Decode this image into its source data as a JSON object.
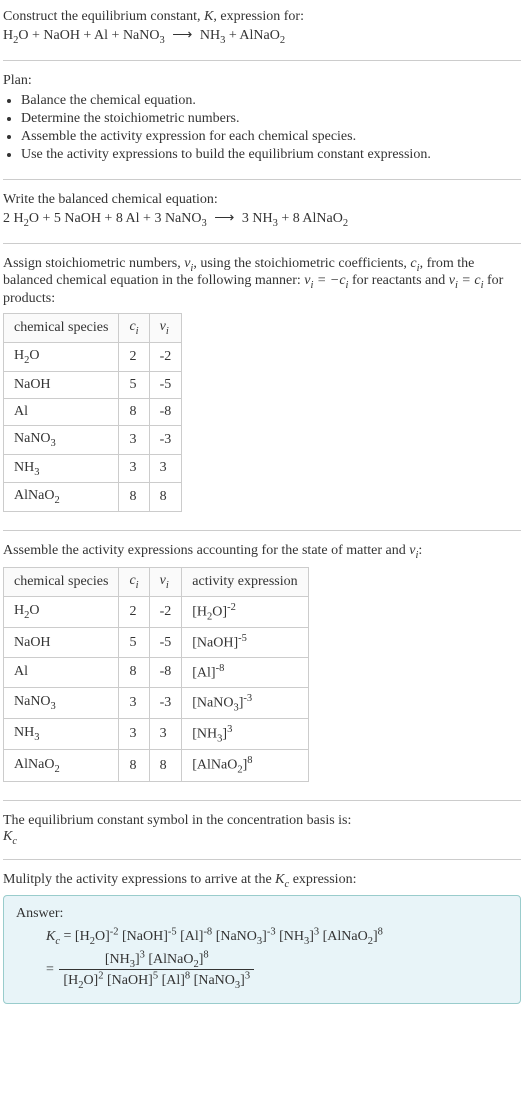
{
  "intro": {
    "line1_a": "Construct the equilibrium constant, ",
    "line1_k": "K",
    "line1_b": ", expression for:",
    "equation_lhs_parts": [
      "H",
      "2",
      "O + NaOH + Al + NaNO",
      "3"
    ],
    "equation_arrow": "⟶",
    "equation_rhs_parts": [
      "NH",
      "3",
      " + AlNaO",
      "2"
    ]
  },
  "plan": {
    "title": "Plan:",
    "items": [
      "Balance the chemical equation.",
      "Determine the stoichiometric numbers.",
      "Assemble the activity expression for each chemical species.",
      "Use the activity expressions to build the equilibrium constant expression."
    ]
  },
  "balanced": {
    "title": "Write the balanced chemical equation:",
    "lhs": "2 H₂O + 5 NaOH + 8 Al + 3 NaNO₃",
    "arrow": "⟶",
    "rhs": "3 NH₃ + 8 AlNaO₂"
  },
  "assign": {
    "text_a": "Assign stoichiometric numbers, ",
    "nu_i": "νᵢ",
    "text_b": ", using the stoichiometric coefficients, ",
    "c_i": "cᵢ",
    "text_c": ", from the balanced chemical equation in the following manner: ",
    "rel1": "νᵢ = −cᵢ",
    "text_d": " for reactants and ",
    "rel2": "νᵢ = cᵢ",
    "text_e": " for products:"
  },
  "table1": {
    "headers": [
      "chemical species",
      "cᵢ",
      "νᵢ"
    ],
    "rows": [
      [
        "H₂O",
        "2",
        "-2"
      ],
      [
        "NaOH",
        "5",
        "-5"
      ],
      [
        "Al",
        "8",
        "-8"
      ],
      [
        "NaNO₃",
        "3",
        "-3"
      ],
      [
        "NH₃",
        "3",
        "3"
      ],
      [
        "AlNaO₂",
        "8",
        "8"
      ]
    ]
  },
  "assemble": {
    "text_a": "Assemble the activity expressions accounting for the state of matter and ",
    "nu_i": "νᵢ",
    "text_b": ":"
  },
  "table2": {
    "headers": [
      "chemical species",
      "cᵢ",
      "νᵢ",
      "activity expression"
    ],
    "rows": [
      {
        "sp": "H₂O",
        "c": "2",
        "n": "-2",
        "base": "[H₂O]",
        "exp": "-2"
      },
      {
        "sp": "NaOH",
        "c": "5",
        "n": "-5",
        "base": "[NaOH]",
        "exp": "-5"
      },
      {
        "sp": "Al",
        "c": "8",
        "n": "-8",
        "base": "[Al]",
        "exp": "-8"
      },
      {
        "sp": "NaNO₃",
        "c": "3",
        "n": "-3",
        "base": "[NaNO₃]",
        "exp": "-3"
      },
      {
        "sp": "NH₃",
        "c": "3",
        "n": "3",
        "base": "[NH₃]",
        "exp": "3"
      },
      {
        "sp": "AlNaO₂",
        "c": "8",
        "n": "8",
        "base": "[AlNaO₂]",
        "exp": "8"
      }
    ]
  },
  "symbol": {
    "line1": "The equilibrium constant symbol in the concentration basis is:",
    "kc": "K",
    "kc_sub": "c"
  },
  "multiply": {
    "text_a": "Mulitply the activity expressions to arrive at the ",
    "kc": "K",
    "kc_sub": "c",
    "text_b": " expression:"
  },
  "answer": {
    "label": "Answer:",
    "kc": "K",
    "kc_sub": "c",
    "eq": " = ",
    "terms": [
      {
        "base": "[H₂O]",
        "exp": "-2"
      },
      {
        "base": "[NaOH]",
        "exp": "-5"
      },
      {
        "base": "[Al]",
        "exp": "-8"
      },
      {
        "base": "[NaNO₃]",
        "exp": "-3"
      },
      {
        "base": "[NH₃]",
        "exp": "3"
      },
      {
        "base": "[AlNaO₂]",
        "exp": "8"
      }
    ],
    "eq2": "= ",
    "num_terms": [
      {
        "base": "[NH₃]",
        "exp": "3"
      },
      {
        "base": "[AlNaO₂]",
        "exp": "8"
      }
    ],
    "den_terms": [
      {
        "base": "[H₂O]",
        "exp": "2"
      },
      {
        "base": "[NaOH]",
        "exp": "5"
      },
      {
        "base": "[Al]",
        "exp": "8"
      },
      {
        "base": "[NaNO₃]",
        "exp": "3"
      }
    ]
  }
}
